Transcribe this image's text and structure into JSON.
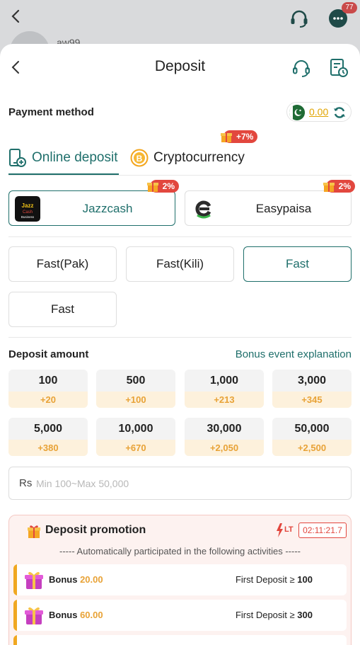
{
  "background": {
    "username": "aw99",
    "notification_count": "77"
  },
  "header": {
    "title": "Deposit"
  },
  "payment_method": {
    "label": "Payment method",
    "balance": "0.00"
  },
  "tabs": [
    {
      "label": "Online deposit",
      "active": true
    },
    {
      "label": "Cryptocurrency",
      "active": false,
      "promo": "+7%"
    }
  ],
  "methods": [
    {
      "label": "Jazzcash",
      "promo": "2%",
      "active": true,
      "logo_text": "JazzCash Business"
    },
    {
      "label": "Easypaisa",
      "promo": "2%",
      "active": false
    }
  ],
  "channels": [
    {
      "label": "Fast(Pak)",
      "active": false
    },
    {
      "label": "Fast(Kili)",
      "active": false
    },
    {
      "label": "Fast",
      "active": true
    },
    {
      "label": "Fast",
      "active": false
    }
  ],
  "deposit_amount": {
    "label": "Deposit amount",
    "bonus_link": "Bonus event explanation"
  },
  "amounts": [
    {
      "value": "100",
      "bonus": "+20"
    },
    {
      "value": "500",
      "bonus": "+100"
    },
    {
      "value": "1,000",
      "bonus": "+213"
    },
    {
      "value": "3,000",
      "bonus": "+345"
    },
    {
      "value": "5,000",
      "bonus": "+380"
    },
    {
      "value": "10,000",
      "bonus": "+670"
    },
    {
      "value": "30,000",
      "bonus": "+2,050"
    },
    {
      "value": "50,000",
      "bonus": "+2,500"
    }
  ],
  "amount_input": {
    "currency": "Rs",
    "placeholder": "Min 100~Max 50,000",
    "value": ""
  },
  "promotion": {
    "title": "Deposit promotion",
    "lt_label": "LT",
    "timer": "02:11:21.7",
    "subtitle": "----- Automatically participated in the following activities -----",
    "items": [
      {
        "label": "Bonus",
        "amount": "20.00",
        "condition": "First Deposit ≥",
        "threshold": "100"
      },
      {
        "label": "Bonus",
        "amount": "60.00",
        "condition": "First Deposit ≥",
        "threshold": "300"
      }
    ]
  },
  "colors": {
    "accent": "#1f6f6b",
    "bonus": "#e8a236",
    "promo_red": "#e2473e"
  }
}
